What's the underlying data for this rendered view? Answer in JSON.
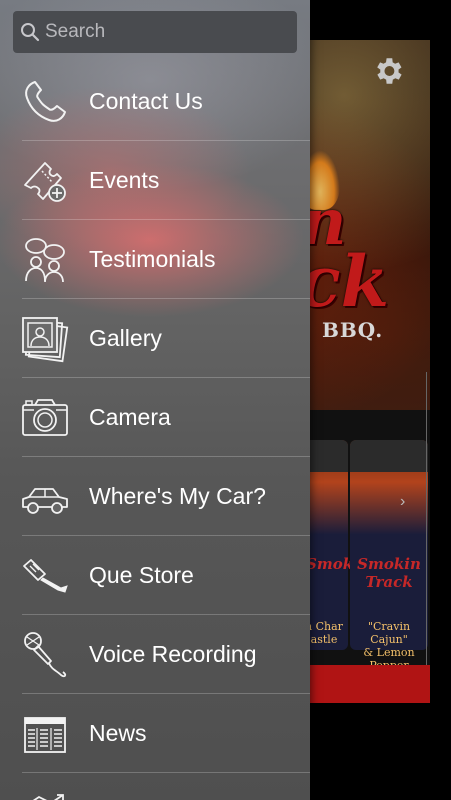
{
  "search": {
    "placeholder": "Search",
    "value": ""
  },
  "menu": {
    "items": [
      {
        "label": "Contact Us",
        "icon": "phone-icon"
      },
      {
        "label": "Events",
        "icon": "ticket-add-icon"
      },
      {
        "label": "Testimonials",
        "icon": "people-chat-icon"
      },
      {
        "label": "Gallery",
        "icon": "gallery-icon"
      },
      {
        "label": "Camera",
        "icon": "camera-icon"
      },
      {
        "label": "Where's My Car?",
        "icon": "car-icon"
      },
      {
        "label": "Que Store",
        "icon": "spatula-icon"
      },
      {
        "label": "Voice Recording",
        "icon": "microphone-icon"
      },
      {
        "label": "News",
        "icon": "newspaper-icon"
      }
    ]
  },
  "background_app": {
    "logo_line_1": "n",
    "logo_line_2": "ck",
    "logo_suffix": "BBQ.",
    "jar_1_label": "Smok",
    "jar_1_sub": "n Char\nastle",
    "jar_2_label": "Smokin Track",
    "jar_2_sub": "\"Cravin Cajun\"\n& Lemon Pepper\nSeasoning"
  },
  "colors": {
    "background_accent": "#b01414",
    "menu_text": "#ffffff",
    "search_bg": "#494b4f"
  }
}
